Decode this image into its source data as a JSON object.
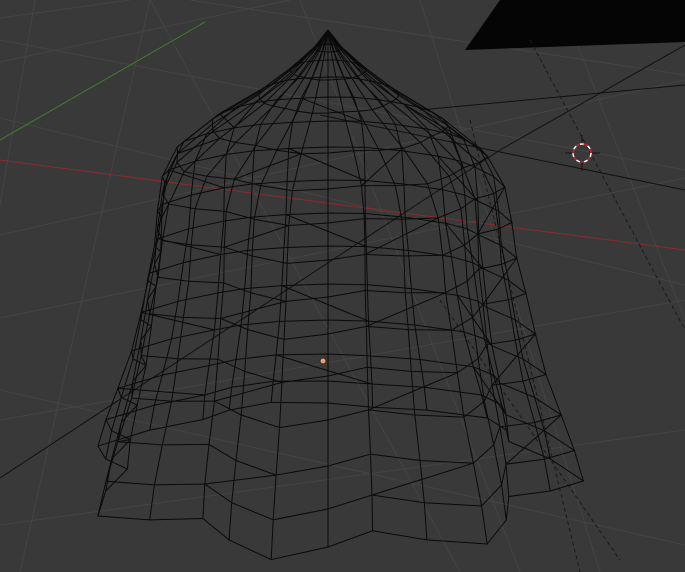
{
  "viewport": {
    "background": "#393939",
    "grid_color": "#444444",
    "x_axis_color": "#8a2a2a",
    "y_axis_color": "#3f7f2f",
    "wire_color": "#0a0a0a",
    "origin_color": "#f0a070",
    "cursor_colors": [
      "#ffffff",
      "#d02020"
    ]
  },
  "icons": {
    "cursor": "3d-cursor-icon",
    "origin": "object-origin-icon"
  }
}
